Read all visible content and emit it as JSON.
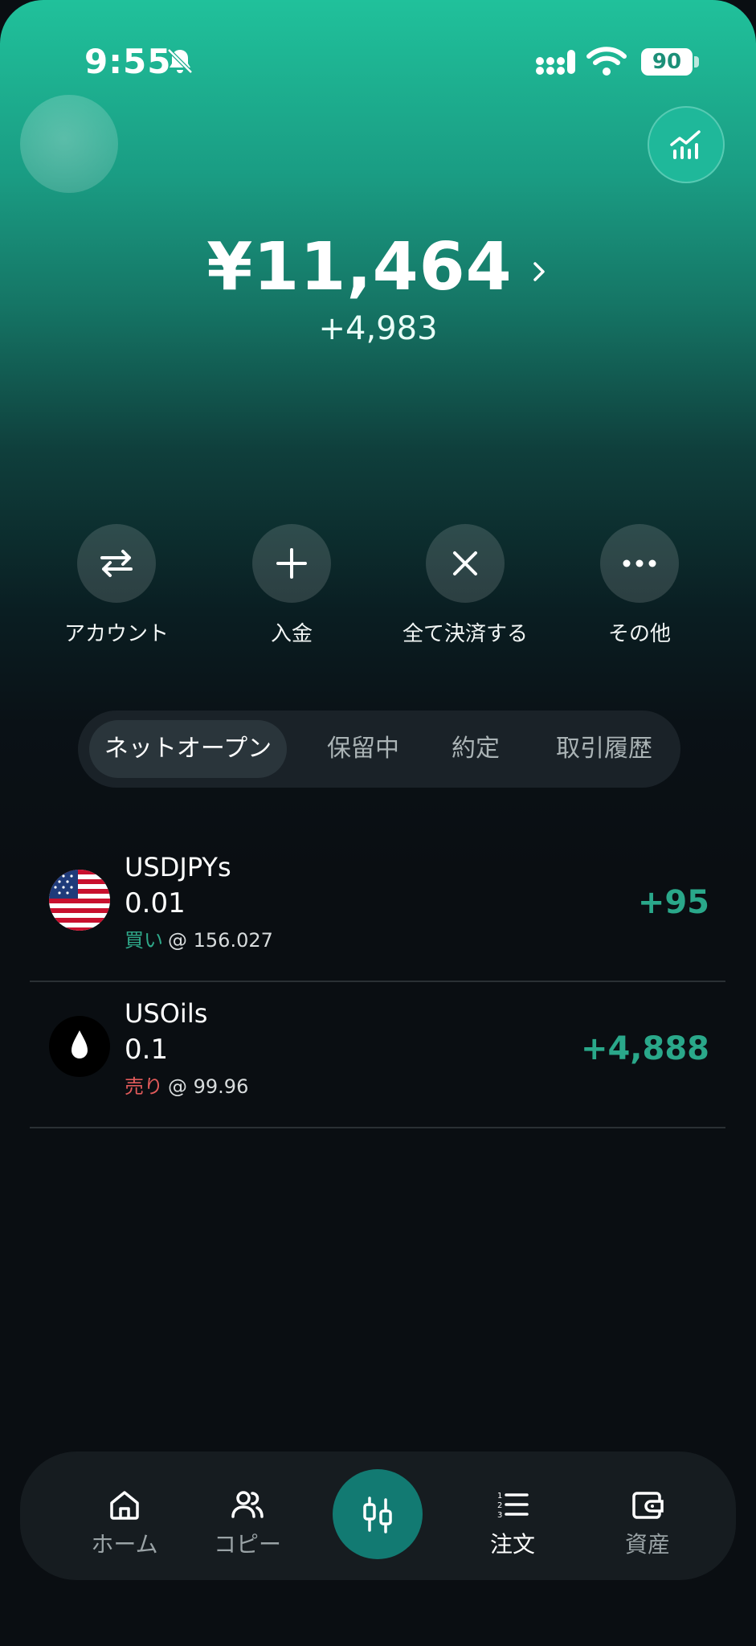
{
  "status_bar": {
    "time": "9:55",
    "battery": "90"
  },
  "account": {
    "balance": "¥11,464",
    "change": "+4,983"
  },
  "actions": [
    {
      "label": "アカウント",
      "icon": "transfer-icon"
    },
    {
      "label": "入金",
      "icon": "plus-icon"
    },
    {
      "label": "全て決済する",
      "icon": "close-icon"
    },
    {
      "label": "その他",
      "icon": "more-icon"
    }
  ],
  "tabs": [
    "ネットオープン",
    "保留中",
    "約定",
    "取引履歴"
  ],
  "positions": [
    {
      "symbol": "USDJPYs",
      "lot": "0.01",
      "side": "買い",
      "price": "@ 156.027",
      "pnl": "+95",
      "icon": "us-flag-icon"
    },
    {
      "symbol": "USOils",
      "lot": "0.1",
      "side": "売り",
      "price": "@ 99.96",
      "pnl": "+4,888",
      "icon": "oil-drop-icon"
    }
  ],
  "nav": [
    {
      "label": "ホーム",
      "icon": "home-icon"
    },
    {
      "label": "コピー",
      "icon": "users-icon"
    },
    {
      "label": "",
      "icon": "candlestick-icon"
    },
    {
      "label": "注文",
      "icon": "list-icon"
    },
    {
      "label": "資産",
      "icon": "wallet-icon"
    }
  ],
  "colors": {
    "accent": "#1fb89a",
    "buy": "#2fa98a",
    "sell": "#e05a5a",
    "nav_center": "#127a72"
  }
}
